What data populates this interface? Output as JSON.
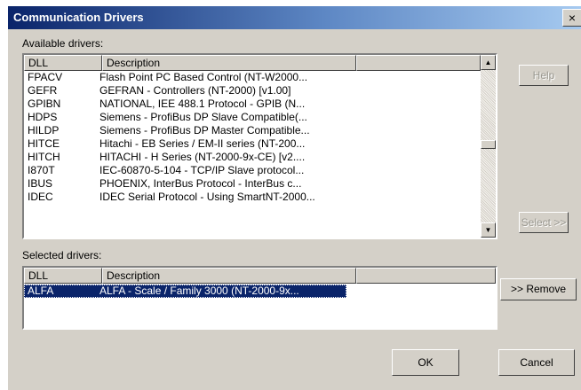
{
  "dialog": {
    "title": "Communication Drivers",
    "close_label": "×"
  },
  "available": {
    "label": "Available drivers:",
    "columns": {
      "dll": "DLL",
      "description": "Description"
    },
    "rows": [
      {
        "dll": "FPACV",
        "description": "Flash Point PC Based Control (NT-W2000..."
      },
      {
        "dll": "GEFR",
        "description": "GEFRAN - Controllers (NT-2000) [v1.00]"
      },
      {
        "dll": "GPIBN",
        "description": "NATIONAL, IEE 488.1 Protocol - GPIB (N..."
      },
      {
        "dll": "HDPS",
        "description": "Siemens - ProfiBus DP Slave Compatible(..."
      },
      {
        "dll": "HILDP",
        "description": "Siemens - ProfiBus DP Master Compatible..."
      },
      {
        "dll": "HITCE",
        "description": "Hitachi - EB Series / EM-II series (NT-200..."
      },
      {
        "dll": "HITCH",
        "description": "HITACHI - H Series (NT-2000-9x-CE) [v2...."
      },
      {
        "dll": "I870T",
        "description": "IEC-60870-5-104 - TCP/IP Slave protocol..."
      },
      {
        "dll": "IBUS",
        "description": "PHOENIX, InterBus Protocol - InterBus c..."
      },
      {
        "dll": "IDEC",
        "description": "IDEC Serial Protocol - Using SmartNT-2000..."
      }
    ]
  },
  "selected": {
    "label": "Selected drivers:",
    "columns": {
      "dll": "DLL",
      "description": "Description"
    },
    "rows": [
      {
        "dll": "ALFA",
        "description": "ALFA  - Scale / Family 3000 (NT-2000-9x..."
      }
    ]
  },
  "buttons": {
    "help": "Help",
    "select": "Select >>",
    "remove": ">> Remove",
    "ok": "OK",
    "cancel": "Cancel"
  },
  "icons": {
    "scroll_up": "arrow-up",
    "scroll_down": "arrow-down"
  }
}
